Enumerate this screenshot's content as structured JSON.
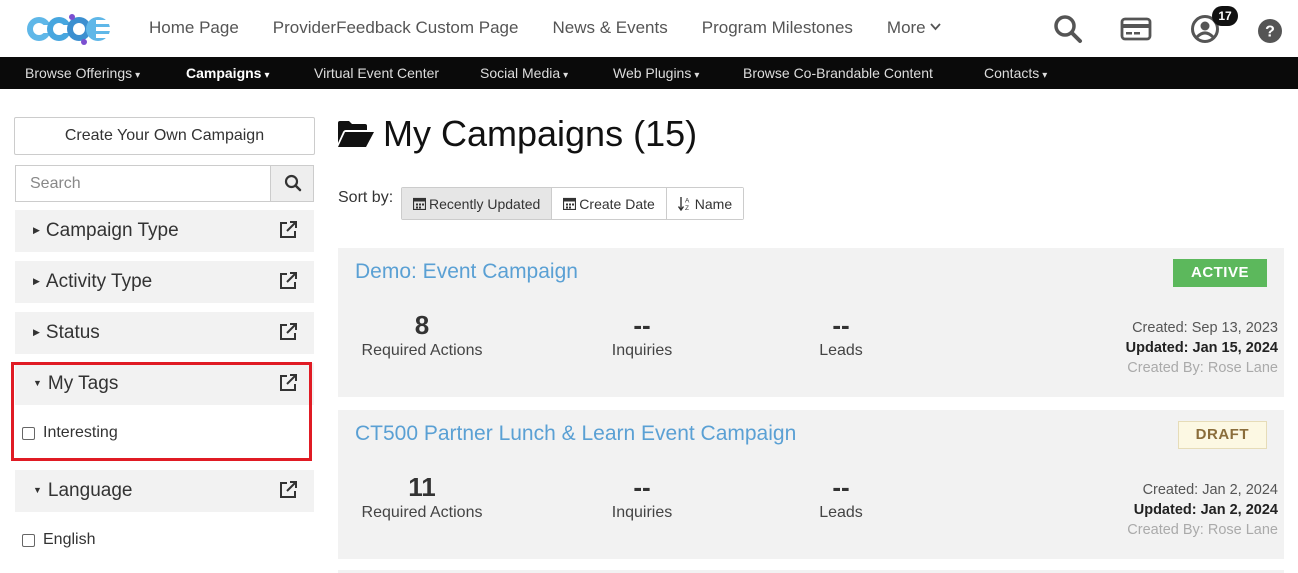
{
  "header": {
    "logo_text": "CCOE",
    "nav": [
      {
        "label": "Home Page"
      },
      {
        "label": "ProviderFeedback Custom Page"
      },
      {
        "label": "News & Events"
      },
      {
        "label": "Program Milestones"
      },
      {
        "label": "More",
        "has_dropdown": true
      }
    ],
    "icons": [
      "search-icon",
      "credit-card-icon",
      "user-circle-icon",
      "help-circle-icon"
    ],
    "notification_count": "17"
  },
  "subnav": {
    "items": [
      {
        "label": "Browse Offerings",
        "has_dropdown": true
      },
      {
        "label": "Campaigns",
        "has_dropdown": true,
        "active": true
      },
      {
        "label": "Virtual Event Center"
      },
      {
        "label": "Social Media",
        "has_dropdown": true
      },
      {
        "label": "Web Plugins",
        "has_dropdown": true
      },
      {
        "label": "Browse Co-Brandable Content"
      },
      {
        "label": "Contacts",
        "has_dropdown": true
      }
    ]
  },
  "sidebar": {
    "create_label": "Create Your Own Campaign",
    "search_placeholder": "Search",
    "facets": [
      {
        "label": "Campaign Type",
        "expanded": false
      },
      {
        "label": "Activity Type",
        "expanded": false
      },
      {
        "label": "Status",
        "expanded": false
      },
      {
        "label": "My Tags",
        "expanded": true,
        "options": [
          {
            "label": "Interesting",
            "checked": false
          }
        ]
      },
      {
        "label": "Language",
        "expanded": true,
        "options": [
          {
            "label": "English",
            "checked": false
          }
        ]
      }
    ]
  },
  "main": {
    "title": "My Campaigns (15)",
    "sort_label": "Sort by:",
    "sort_options": [
      {
        "label": "Recently Updated",
        "active": true,
        "icon": "calendar-icon"
      },
      {
        "label": "Create Date",
        "active": false,
        "icon": "calendar-icon"
      },
      {
        "label": "Name",
        "active": false,
        "icon": "sort-alpha-icon"
      }
    ],
    "campaigns": [
      {
        "name": "Demo: Event Campaign",
        "status": "ACTIVE",
        "required_actions": "8",
        "required_actions_label": "Required Actions",
        "inquiries": "--",
        "inquiries_label": "Inquiries",
        "leads": "--",
        "leads_label": "Leads",
        "created": "Created: Sep 13, 2023",
        "updated": "Updated: Jan 15, 2024",
        "created_by": "Created By: Rose Lane"
      },
      {
        "name": "CT500 Partner Lunch & Learn Event Campaign",
        "status": "DRAFT",
        "required_actions": "11",
        "required_actions_label": "Required Actions",
        "inquiries": "--",
        "inquiries_label": "Inquiries",
        "leads": "--",
        "leads_label": "Leads",
        "created": "Created: Jan 2, 2024",
        "updated": "Updated: Jan 2, 2024",
        "created_by": "Created By: Rose Lane"
      }
    ]
  },
  "colors": {
    "accent_link": "#5aa0d4",
    "active_status": "#5cb85c",
    "draft_status_bg": "#fcf8e3",
    "highlight_border": "#e01b24",
    "navbar_bg": "#0a0a0a"
  }
}
